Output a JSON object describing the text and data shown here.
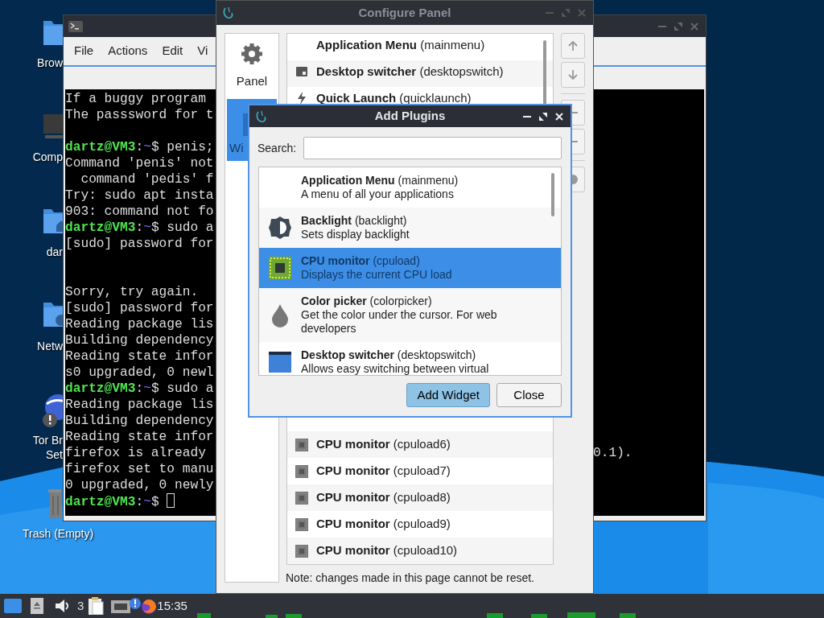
{
  "desktop": {
    "icons": [
      {
        "kind": "folder",
        "label": "Brow"
      },
      {
        "kind": "computer",
        "label": "Comp"
      },
      {
        "kind": "home",
        "label": "dar"
      },
      {
        "kind": "network",
        "label": "Netw"
      },
      {
        "kind": "tor",
        "label": "Tor Br",
        "label_2": "Set"
      },
      {
        "kind": "trash",
        "label": "Trash (Empty)"
      }
    ]
  },
  "terminal": {
    "menu": [
      "File",
      "Actions",
      "Edit",
      "Vi"
    ],
    "lines": [
      {
        "kind": "plain",
        "text": "If a buggy program"
      },
      {
        "kind": "plain",
        "text": "The passsword for t"
      },
      {
        "kind": "blank"
      },
      {
        "kind": "prompt",
        "segments": [
          {
            "kind": "user",
            "text": "dartz@VM3"
          },
          {
            "kind": "plain",
            "text": ":"
          },
          {
            "kind": "path",
            "text": "~"
          },
          {
            "kind": "plain",
            "text": "$ penis;"
          }
        ]
      },
      {
        "kind": "plain",
        "text": "Command 'penis' not"
      },
      {
        "kind": "plain",
        "text": "  command 'pedis' f"
      },
      {
        "kind": "plain",
        "text": "Try: sudo apt insta"
      },
      {
        "kind": "plain",
        "text": "903: command not fo"
      },
      {
        "kind": "prompt",
        "segments": [
          {
            "kind": "user",
            "text": "dartz@VM3"
          },
          {
            "kind": "plain",
            "text": ":"
          },
          {
            "kind": "path",
            "text": "~"
          },
          {
            "kind": "plain",
            "text": "$ sudo a"
          }
        ]
      },
      {
        "kind": "plain",
        "text": "[sudo] password for"
      },
      {
        "kind": "blank"
      },
      {
        "kind": "blank"
      },
      {
        "kind": "plain",
        "text": "Sorry, try again."
      },
      {
        "kind": "plain",
        "text": "[sudo] password for"
      },
      {
        "kind": "plain",
        "text": "Reading package lis"
      },
      {
        "kind": "plain",
        "text": "Building dependency"
      },
      {
        "kind": "plain",
        "text": "Reading state infor"
      },
      {
        "kind": "plain",
        "text": "s0 upgraded, 0 newl"
      },
      {
        "kind": "prompt",
        "segments": [
          {
            "kind": "user",
            "text": "dartz@VM3"
          },
          {
            "kind": "plain",
            "text": ":"
          },
          {
            "kind": "path",
            "text": "~"
          },
          {
            "kind": "plain",
            "text": "$ sudo a"
          }
        ]
      },
      {
        "kind": "plain",
        "text": "Reading package lis"
      },
      {
        "kind": "plain",
        "text": "Building dependency"
      },
      {
        "kind": "plain",
        "text": "Reading state infor"
      },
      {
        "kind": "plain",
        "text": "firefox is already",
        "tail": "0.1)."
      },
      {
        "kind": "plain",
        "text": "firefox set to manu"
      },
      {
        "kind": "plain",
        "text": "0 upgraded, 0 newly"
      },
      {
        "kind": "prompt",
        "cursor": true,
        "segments": [
          {
            "kind": "user",
            "text": "dartz@VM3"
          },
          {
            "kind": "plain",
            "text": ":"
          },
          {
            "kind": "path",
            "text": "~"
          },
          {
            "kind": "plain",
            "text": "$ "
          }
        ]
      }
    ]
  },
  "configure_panel": {
    "title": "Configure Panel",
    "sidebar": [
      {
        "kind": "gear",
        "label": "Panel",
        "selected": false
      },
      {
        "kind": "widgets",
        "label": "Wi",
        "selected": true
      }
    ],
    "plugins": [
      {
        "kind": "none",
        "text": "**Application Menu** (mainmenu)"
      },
      {
        "kind": "desktopswitch",
        "text": "**Desktop switcher** (desktopswitch)"
      },
      {
        "kind": "quicklaunch",
        "text": "**Quick Launch** (quicklaunch)"
      }
    ],
    "plugins_lower": [
      {
        "kind": "cpuload",
        "text": "**CPU monitor** (cpuload6)"
      },
      {
        "kind": "cpuload",
        "text": "**CPU monitor** (cpuload7)"
      },
      {
        "kind": "cpuload",
        "text": "**CPU monitor** (cpuload8)"
      },
      {
        "kind": "cpuload",
        "text": "**CPU monitor** (cpuload9)"
      },
      {
        "kind": "cpuload",
        "text": "**CPU monitor** (cpuload10)"
      }
    ],
    "side_buttons": [
      {
        "kind": "up"
      },
      {
        "kind": "down"
      },
      {
        "kind": "minus"
      },
      {
        "kind": "minus"
      },
      {
        "kind": "circle"
      }
    ],
    "note": "Note: changes made in this page cannot be reset."
  },
  "add_plugins": {
    "title": "Add Plugins",
    "search": {
      "label": "Search:"
    },
    "plugins": [
      {
        "kind": "none",
        "text": "**Application Menu** (mainmenu)",
        "description": "A menu of all your applications",
        "selected": false
      },
      {
        "kind": "backlight",
        "text": "**Backlight** (backlight)",
        "description": "Sets display backlight",
        "selected": false
      },
      {
        "kind": "cpu",
        "text": "**CPU monitor** (cpuload)",
        "description": "Displays the current CPU load",
        "selected": true
      },
      {
        "kind": "colorpicker",
        "text": "**Color picker** (colorpicker)",
        "description": "Get the color under the cursor. For web developers",
        "selected": false
      },
      {
        "kind": "desktopswitch",
        "text": "**Desktop switcher** (desktopswitch)",
        "description": "Allows easy switching between virtual",
        "selected": false
      }
    ],
    "buttons": [
      {
        "label": "Add Widget",
        "default": true
      },
      {
        "label": "Close",
        "default": false
      }
    ]
  },
  "taskbar": {
    "volume": "3",
    "clock": "15:35"
  }
}
